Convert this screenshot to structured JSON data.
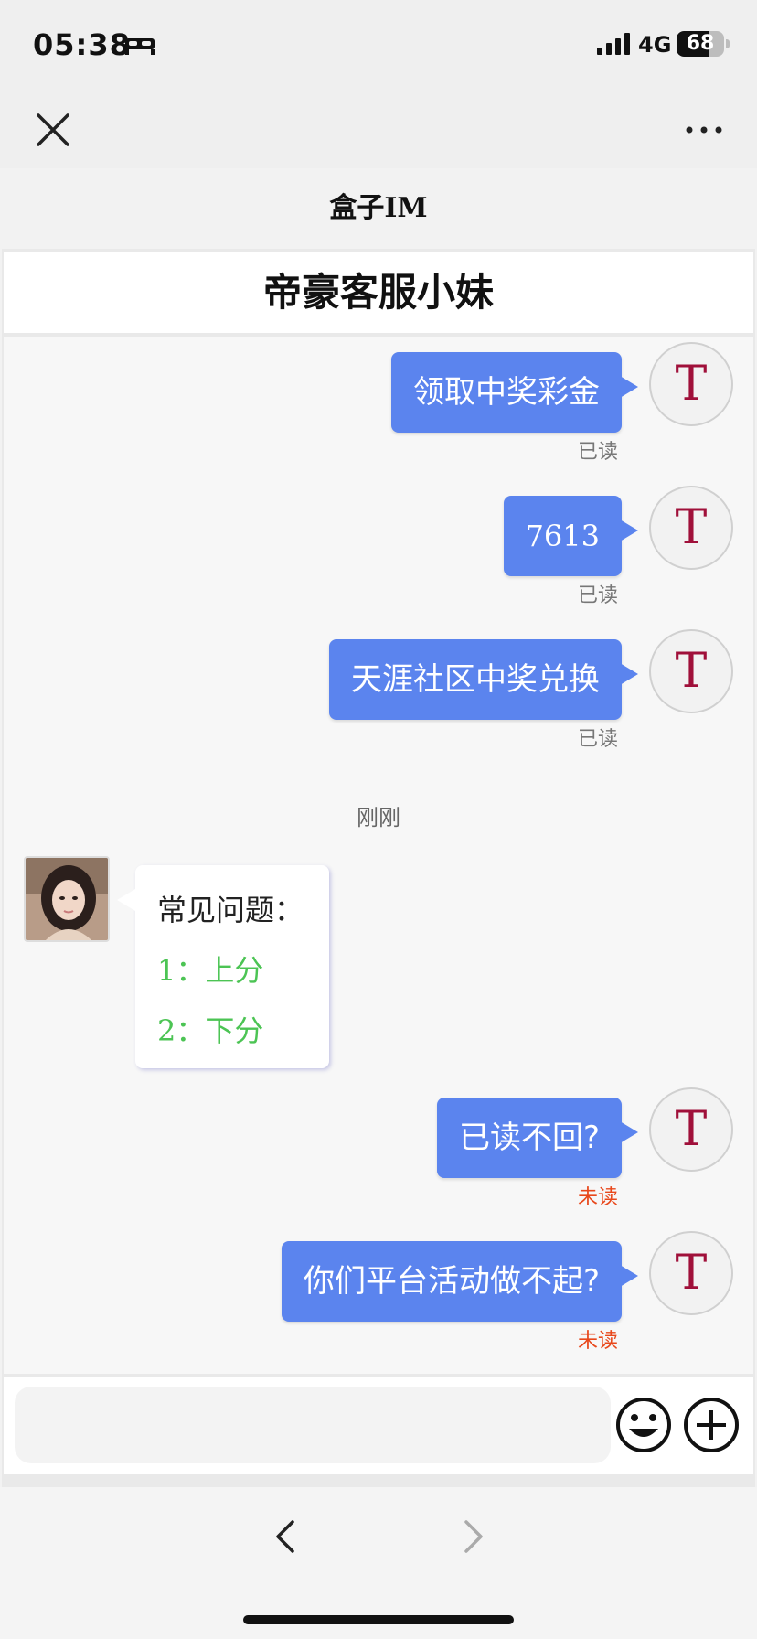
{
  "status_bar": {
    "time": "05:38",
    "network": "4G",
    "battery": "68",
    "battery_level": 0.68
  },
  "nav": {
    "title": "盒子IM"
  },
  "chat": {
    "contact_name": "帝豪客服小妹",
    "avatar_letter": "T",
    "outgoing_top": [
      {
        "text": "领取中奖彩金",
        "status": "已读"
      },
      {
        "text": "7613",
        "status": "已读"
      },
      {
        "text": "天涯社区中奖兑换",
        "status": "已读"
      }
    ],
    "time_separator": "刚刚",
    "incoming": {
      "title": "常见问题：",
      "items": [
        {
          "num": "1：",
          "label": "上分"
        },
        {
          "num": "2：",
          "label": "下分"
        }
      ]
    },
    "outgoing_bottom": [
      {
        "text": "已读不回?",
        "status": "未读"
      },
      {
        "text": "你们平台活动做不起?",
        "status": "未读"
      }
    ]
  },
  "input": {
    "placeholder": ""
  },
  "colors": {
    "bubble_out": "#5b84ee",
    "avatar_letter": "#a0103a",
    "faq_green": "#4cc454",
    "unread": "#e8481c"
  }
}
